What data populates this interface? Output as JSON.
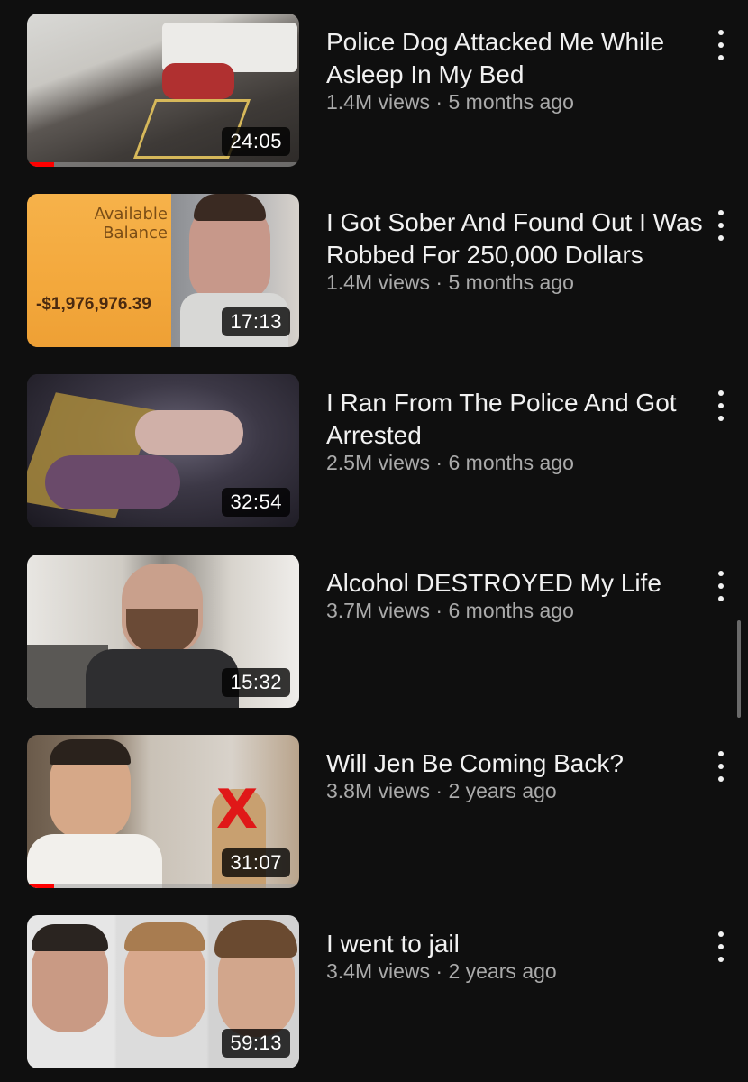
{
  "videos": [
    {
      "title": "Police Dog Attacked Me While Asleep In My Bed",
      "views": "1.4M views",
      "age": "5 months ago",
      "duration": "24:05",
      "watched_fraction": 0.1
    },
    {
      "title": "I Got Sober And Found Out I Was Robbed For 250,000 Dollars",
      "views": "1.4M views",
      "age": "5 months ago",
      "duration": "17:13",
      "thumb_text": {
        "label": "Available Balance",
        "amount": "-$1,976,976.39"
      }
    },
    {
      "title": "I Ran From The Police And Got Arrested",
      "views": "2.5M views",
      "age": "6 months ago",
      "duration": "32:54"
    },
    {
      "title": "Alcohol DESTROYED My Life",
      "views": "3.7M views",
      "age": "6 months ago",
      "duration": "15:32"
    },
    {
      "title": "Will Jen Be Coming Back?",
      "views": "3.8M views",
      "age": "2 years ago",
      "duration": "31:07",
      "watched_fraction": 0.1,
      "thumb_mark": "X"
    },
    {
      "title": "I went to jail",
      "views": "3.4M views",
      "age": "2 years ago",
      "duration": "59:13"
    }
  ],
  "separator": " · ",
  "colors": {
    "background": "#0f0f0f",
    "title": "#f1f1f1",
    "meta": "#aaaaaa",
    "progress": "#ff0000"
  }
}
